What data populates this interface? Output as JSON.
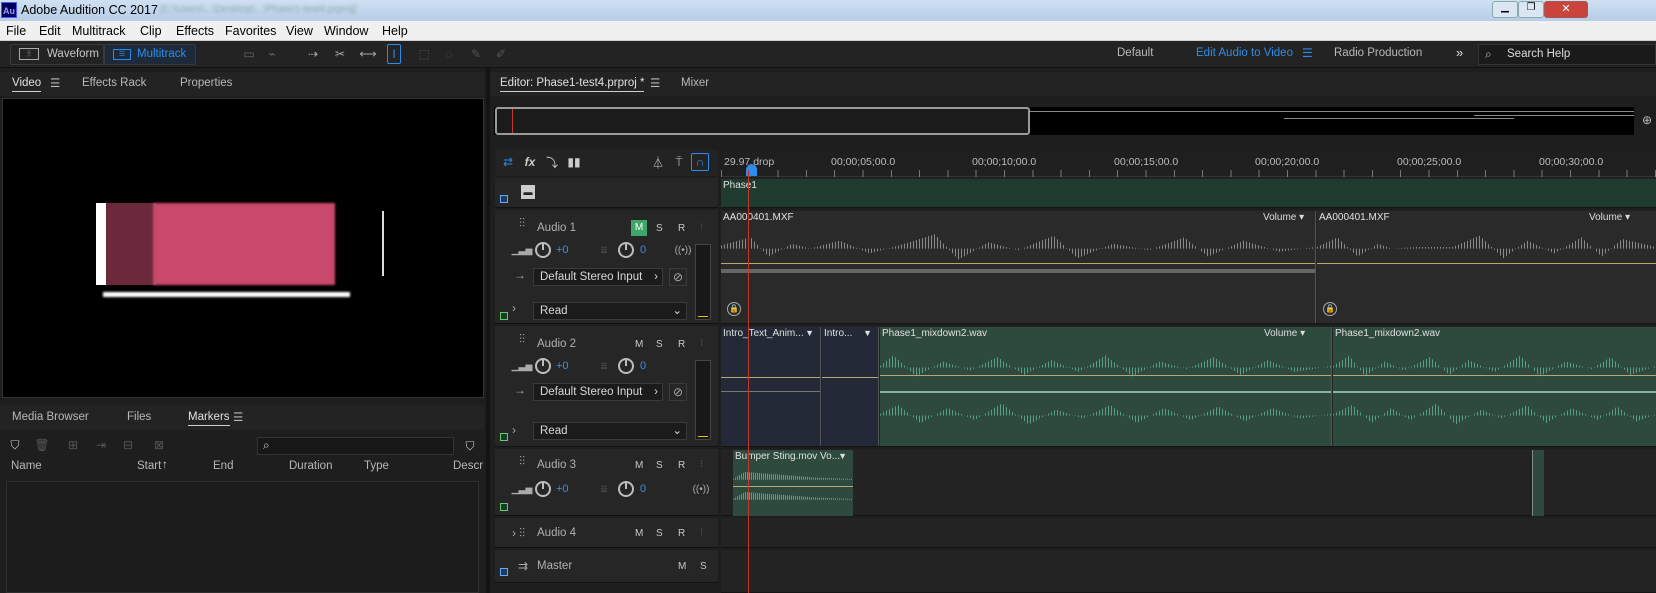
{
  "app": {
    "title": "Adobe Audition CC 2017",
    "icon_text": "Au",
    "file_path_blurred": "[C:\\Users\\...\\Desktop\\...\\Phase1-test4.prproj]"
  },
  "menu": [
    "File",
    "Edit",
    "Multitrack",
    "Clip",
    "Effects",
    "Favorites",
    "View",
    "Window",
    "Help"
  ],
  "toolbar": {
    "waveform": "Waveform",
    "multitrack": "Multitrack",
    "workspaces": [
      "Default",
      "Edit Audio to Video",
      "Radio Production"
    ],
    "search": "Search Help"
  },
  "left_panel": {
    "tabs": [
      "Video",
      "Effects Rack",
      "Properties"
    ],
    "active": "Video"
  },
  "lower_panel": {
    "tabs": [
      "Media Browser",
      "Files",
      "Markers"
    ],
    "active": "Markers",
    "columns": [
      "Name",
      "Start",
      "End",
      "Duration",
      "Type",
      "Descr"
    ]
  },
  "editor": {
    "tabs": [
      "Editor: Phase1-test4.prproj *",
      "Mixer"
    ]
  },
  "ruler": {
    "labels": [
      "29.97 drop",
      "00;00;05;00.0",
      "00;00;10;00.0",
      "00;00;15;00.0",
      "00;00;20;00.0",
      "00;00;25;00.0",
      "00;00;30;00.0"
    ]
  },
  "video_track": {
    "clip": "Phase1"
  },
  "tracks": [
    {
      "name": "Audio 1",
      "vol": "+0",
      "pan": "0",
      "input": "Default Stereo Input",
      "mode": "Read"
    },
    {
      "name": "Audio 2",
      "vol": "+0",
      "pan": "0",
      "input": "Default Stereo Input",
      "mode": "Read"
    },
    {
      "name": "Audio 3",
      "vol": "+0",
      "pan": "0"
    },
    {
      "name": "Audio 4"
    },
    {
      "name": "Master"
    }
  ],
  "buttons": {
    "m": "M",
    "s": "S",
    "r": "R"
  },
  "clips": {
    "a1": [
      "AA000401.MXF",
      "AA000401.MXF"
    ],
    "a2": [
      "Intro_Text_Anim...",
      "Intro...",
      "Phase1_mixdown2.wav",
      "Phase1_mixdown2.wav"
    ],
    "a3": [
      "Bumper Sting.mov Vo..."
    ],
    "volume": "Volume"
  },
  "colors": {
    "accent": "#2d8ceb",
    "audio1_wave": "#8a8a8a",
    "audio2_clip": "#2e4a3e",
    "audio2_wave": "#57a085",
    "video_clip": "#1f3a2e",
    "video_frame": "#c9496c",
    "playhead": "#c0392b"
  }
}
